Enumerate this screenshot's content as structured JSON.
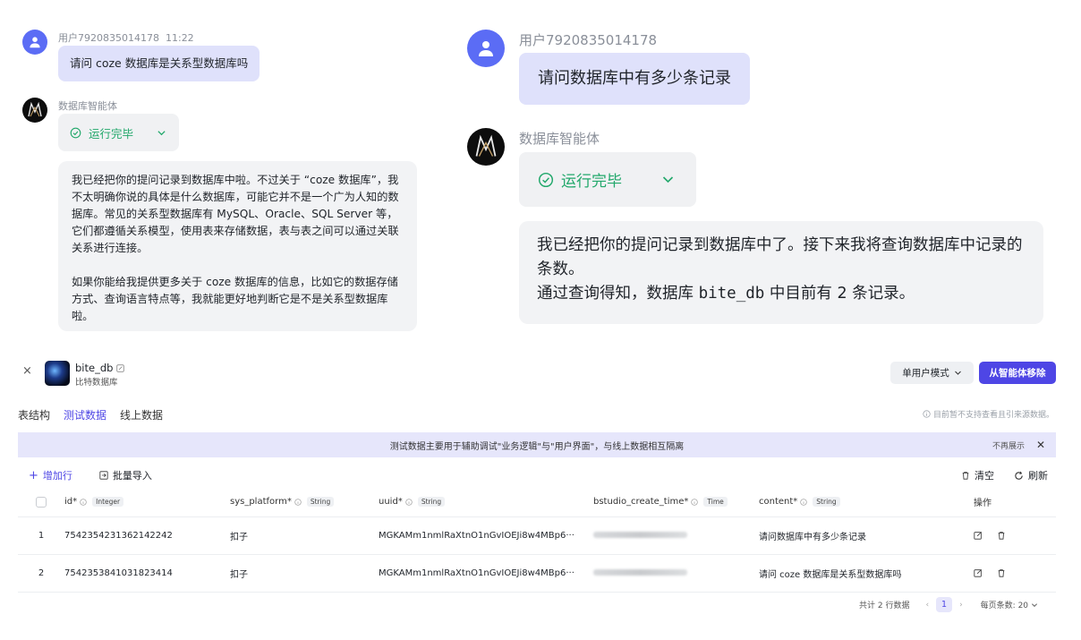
{
  "chat_left": {
    "user_name": "用户7920835014178",
    "time": "11:22",
    "user_message": "请问 coze 数据库是关系型数据库吗",
    "bot_name": "数据库智能体",
    "status": "运行完毕",
    "reply_p1": "我已经把你的提问记录到数据库中啦。不过关于 “coze 数据库”，我不太明确你说的具体是什么数据库，可能它并不是一个广为人知的数据库。常见的关系型数据库有 MySQL、Oracle、SQL Server 等，它们都遵循关系模型，使用表来存储数据，表与表之间可以通过关联关系进行连接。",
    "reply_p2": "如果你能给我提供更多关于 coze 数据库的信息，比如它的数据存储方式、查询语言特点等，我就能更好地判断它是不是关系型数据库啦。"
  },
  "chat_right": {
    "user_name": "用户7920835014178",
    "user_message": "请问数据库中有多少条记录",
    "bot_name": "数据库智能体",
    "status": "运行完毕",
    "reply_line1": "我已经把你的提问记录到数据库中了。接下来我将查询数据库中记录的条数。",
    "reply_line2_pre": "通过查询得知，数据库 ",
    "reply_line2_code": "bite_db",
    "reply_line2_post": " 中目前有 2 条记录。"
  },
  "db": {
    "close": "×",
    "name": "bite_db",
    "description": "比特数据库",
    "mode_label": "单用户模式",
    "remove_label": "从智能体移除",
    "tabs": [
      "表结构",
      "测试数据",
      "线上数据"
    ],
    "active_tab": "测试数据",
    "tab_note": "目前暂不支持查看且引来源数据。",
    "banner_text": "测试数据主要用于辅助调试\"业务逻辑\"与\"用户界面\"，与线上数据相互隔离",
    "banner_dismiss": "不再展示",
    "add_row": "增加行",
    "bulk_import": "批量导入",
    "clear": "清空",
    "refresh": "刷新",
    "columns": [
      {
        "name": "id*",
        "type": "Integer"
      },
      {
        "name": "sys_platform*",
        "type": "String"
      },
      {
        "name": "uuid*",
        "type": "String"
      },
      {
        "name": "bstudio_create_time*",
        "type": "Time"
      },
      {
        "name": "content*",
        "type": "String"
      }
    ],
    "ops_header": "操作",
    "rows": [
      {
        "index": "1",
        "id": "7542354231362142242",
        "sys_platform": "扣子",
        "uuid": "MGKAMm1nmlRaXtnO1nGvIOEJi8w4MBp6···",
        "content": "请问数据库中有多少条记录"
      },
      {
        "index": "2",
        "id": "7542353841031823414",
        "sys_platform": "扣子",
        "uuid": "MGKAMm1nmlRaXtnO1nGvIOEJi8w4MBp6···",
        "content": "请问 coze 数据库是关系型数据库吗"
      }
    ],
    "total_text": "共计 2 行数据",
    "current_page": "1",
    "page_size_label": "每页条数: 20"
  },
  "colors": {
    "accent": "#4e46e5",
    "success": "#22a86b",
    "user_bubble": "#dfe1fb",
    "bot_bubble": "#f2f3f5"
  }
}
